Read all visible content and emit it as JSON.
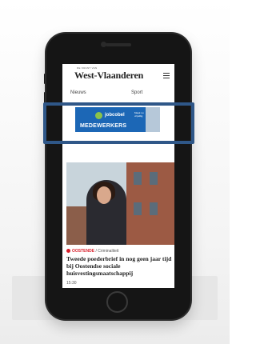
{
  "site": {
    "brand_small": "DE KRANT VAN",
    "brand": "West-Vlaanderen"
  },
  "nav": {
    "items": [
      "Nieuws",
      "Sport"
    ]
  },
  "ad": {
    "brand": "jobcobel",
    "headline": "MEDEWERKERS",
    "tagline": "Maak nu vrijwillig"
  },
  "article": {
    "city": "OOSTENDE",
    "category": "Criminaliteit",
    "headline": "Tweede poederbrief in nog geen jaar tijd bij Oostendse sociale huisvestingsmaatschappij",
    "time": "15:30"
  },
  "colors": {
    "accent": "#d81e2a",
    "highlight": "#2f5788",
    "ad_bg": "#1c67b6"
  }
}
